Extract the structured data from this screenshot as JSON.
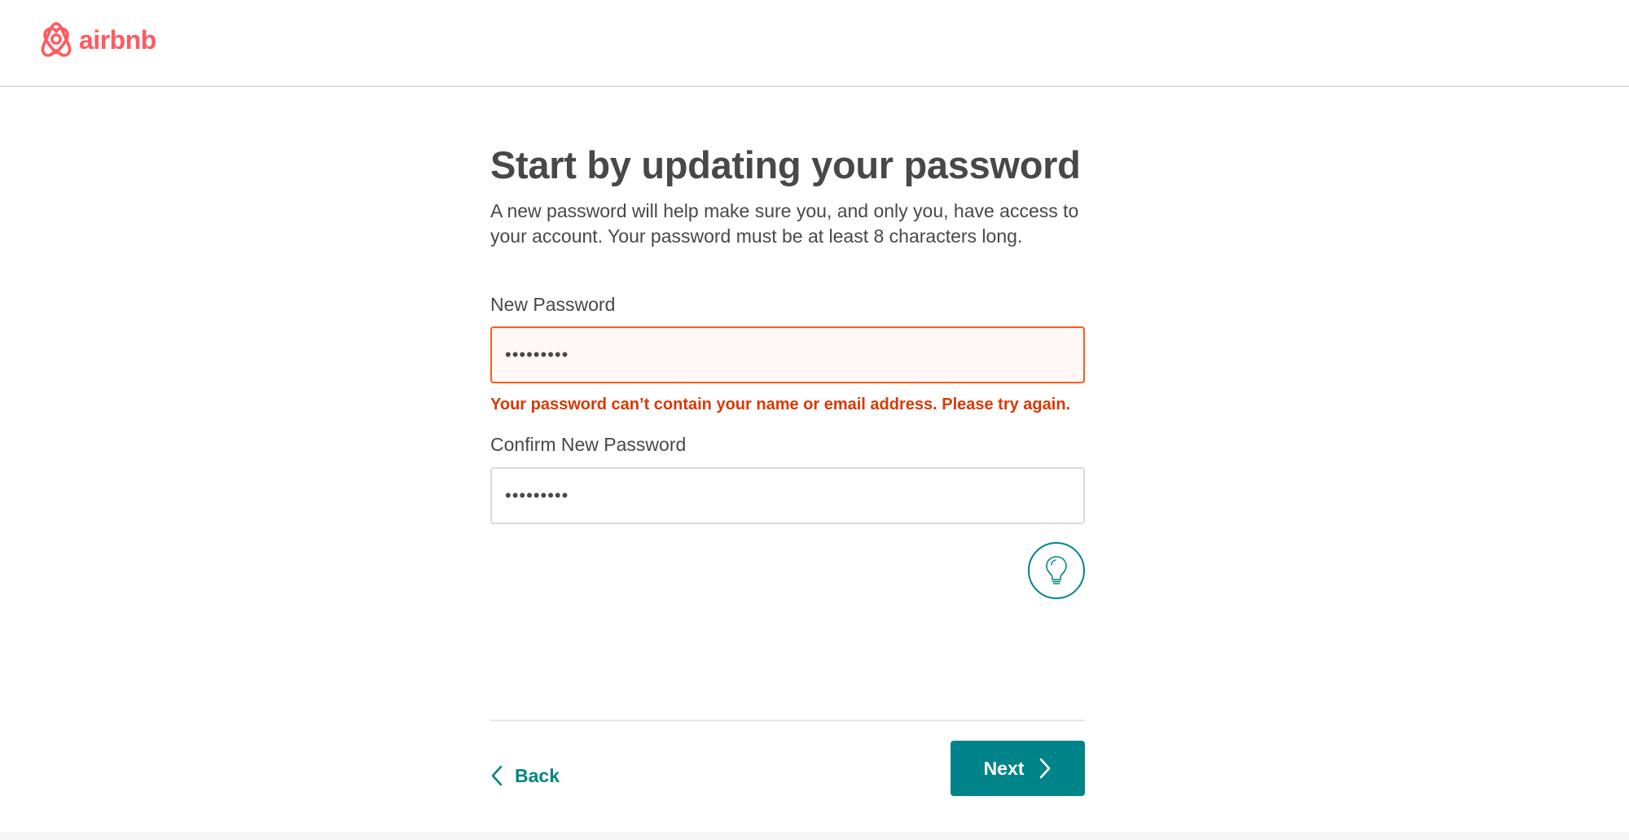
{
  "brand": {
    "name": "airbnb",
    "color": "#FF5A5F"
  },
  "page": {
    "title": "Start by updating your password",
    "subtitle": "A new password will help make sure you, and only you, have access to your account. Your password must be at least 8 characters long."
  },
  "form": {
    "new_password": {
      "label": "New Password",
      "value": "•••••••••",
      "state": "error",
      "error": "Your password can’t contain your name or email address. Please try again."
    },
    "confirm_password": {
      "label": "Confirm New Password",
      "value": "•••••••••"
    },
    "tip_icon": "lightbulb-icon"
  },
  "nav": {
    "back_label": "Back",
    "back_icon": "chevron-left-icon",
    "next_label": "Next",
    "next_icon": "chevron-right-icon"
  },
  "colors": {
    "accent": "#008489",
    "error": "#D93900",
    "error_border": "#FF5A1F",
    "text": "#484848"
  }
}
